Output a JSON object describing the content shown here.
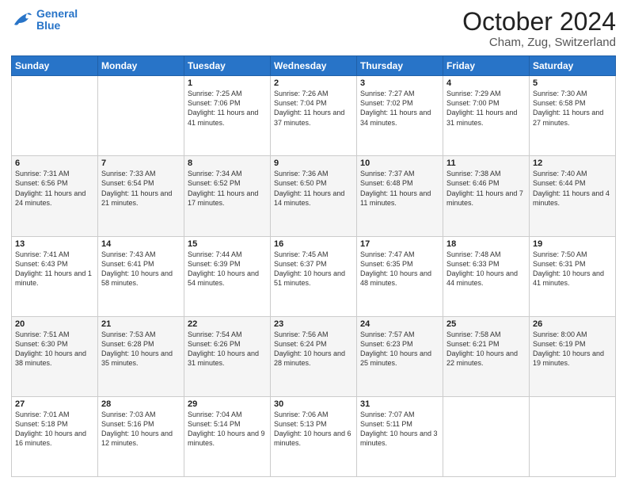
{
  "header": {
    "logo_line1": "General",
    "logo_line2": "Blue",
    "title": "October 2024",
    "subtitle": "Cham, Zug, Switzerland"
  },
  "days_of_week": [
    "Sunday",
    "Monday",
    "Tuesday",
    "Wednesday",
    "Thursday",
    "Friday",
    "Saturday"
  ],
  "weeks": [
    [
      {
        "day": "",
        "info": ""
      },
      {
        "day": "",
        "info": ""
      },
      {
        "day": "1",
        "info": "Sunrise: 7:25 AM\nSunset: 7:06 PM\nDaylight: 11 hours and 41 minutes."
      },
      {
        "day": "2",
        "info": "Sunrise: 7:26 AM\nSunset: 7:04 PM\nDaylight: 11 hours and 37 minutes."
      },
      {
        "day": "3",
        "info": "Sunrise: 7:27 AM\nSunset: 7:02 PM\nDaylight: 11 hours and 34 minutes."
      },
      {
        "day": "4",
        "info": "Sunrise: 7:29 AM\nSunset: 7:00 PM\nDaylight: 11 hours and 31 minutes."
      },
      {
        "day": "5",
        "info": "Sunrise: 7:30 AM\nSunset: 6:58 PM\nDaylight: 11 hours and 27 minutes."
      }
    ],
    [
      {
        "day": "6",
        "info": "Sunrise: 7:31 AM\nSunset: 6:56 PM\nDaylight: 11 hours and 24 minutes."
      },
      {
        "day": "7",
        "info": "Sunrise: 7:33 AM\nSunset: 6:54 PM\nDaylight: 11 hours and 21 minutes."
      },
      {
        "day": "8",
        "info": "Sunrise: 7:34 AM\nSunset: 6:52 PM\nDaylight: 11 hours and 17 minutes."
      },
      {
        "day": "9",
        "info": "Sunrise: 7:36 AM\nSunset: 6:50 PM\nDaylight: 11 hours and 14 minutes."
      },
      {
        "day": "10",
        "info": "Sunrise: 7:37 AM\nSunset: 6:48 PM\nDaylight: 11 hours and 11 minutes."
      },
      {
        "day": "11",
        "info": "Sunrise: 7:38 AM\nSunset: 6:46 PM\nDaylight: 11 hours and 7 minutes."
      },
      {
        "day": "12",
        "info": "Sunrise: 7:40 AM\nSunset: 6:44 PM\nDaylight: 11 hours and 4 minutes."
      }
    ],
    [
      {
        "day": "13",
        "info": "Sunrise: 7:41 AM\nSunset: 6:43 PM\nDaylight: 11 hours and 1 minute."
      },
      {
        "day": "14",
        "info": "Sunrise: 7:43 AM\nSunset: 6:41 PM\nDaylight: 10 hours and 58 minutes."
      },
      {
        "day": "15",
        "info": "Sunrise: 7:44 AM\nSunset: 6:39 PM\nDaylight: 10 hours and 54 minutes."
      },
      {
        "day": "16",
        "info": "Sunrise: 7:45 AM\nSunset: 6:37 PM\nDaylight: 10 hours and 51 minutes."
      },
      {
        "day": "17",
        "info": "Sunrise: 7:47 AM\nSunset: 6:35 PM\nDaylight: 10 hours and 48 minutes."
      },
      {
        "day": "18",
        "info": "Sunrise: 7:48 AM\nSunset: 6:33 PM\nDaylight: 10 hours and 44 minutes."
      },
      {
        "day": "19",
        "info": "Sunrise: 7:50 AM\nSunset: 6:31 PM\nDaylight: 10 hours and 41 minutes."
      }
    ],
    [
      {
        "day": "20",
        "info": "Sunrise: 7:51 AM\nSunset: 6:30 PM\nDaylight: 10 hours and 38 minutes."
      },
      {
        "day": "21",
        "info": "Sunrise: 7:53 AM\nSunset: 6:28 PM\nDaylight: 10 hours and 35 minutes."
      },
      {
        "day": "22",
        "info": "Sunrise: 7:54 AM\nSunset: 6:26 PM\nDaylight: 10 hours and 31 minutes."
      },
      {
        "day": "23",
        "info": "Sunrise: 7:56 AM\nSunset: 6:24 PM\nDaylight: 10 hours and 28 minutes."
      },
      {
        "day": "24",
        "info": "Sunrise: 7:57 AM\nSunset: 6:23 PM\nDaylight: 10 hours and 25 minutes."
      },
      {
        "day": "25",
        "info": "Sunrise: 7:58 AM\nSunset: 6:21 PM\nDaylight: 10 hours and 22 minutes."
      },
      {
        "day": "26",
        "info": "Sunrise: 8:00 AM\nSunset: 6:19 PM\nDaylight: 10 hours and 19 minutes."
      }
    ],
    [
      {
        "day": "27",
        "info": "Sunrise: 7:01 AM\nSunset: 5:18 PM\nDaylight: 10 hours and 16 minutes."
      },
      {
        "day": "28",
        "info": "Sunrise: 7:03 AM\nSunset: 5:16 PM\nDaylight: 10 hours and 12 minutes."
      },
      {
        "day": "29",
        "info": "Sunrise: 7:04 AM\nSunset: 5:14 PM\nDaylight: 10 hours and 9 minutes."
      },
      {
        "day": "30",
        "info": "Sunrise: 7:06 AM\nSunset: 5:13 PM\nDaylight: 10 hours and 6 minutes."
      },
      {
        "day": "31",
        "info": "Sunrise: 7:07 AM\nSunset: 5:11 PM\nDaylight: 10 hours and 3 minutes."
      },
      {
        "day": "",
        "info": ""
      },
      {
        "day": "",
        "info": ""
      }
    ]
  ]
}
